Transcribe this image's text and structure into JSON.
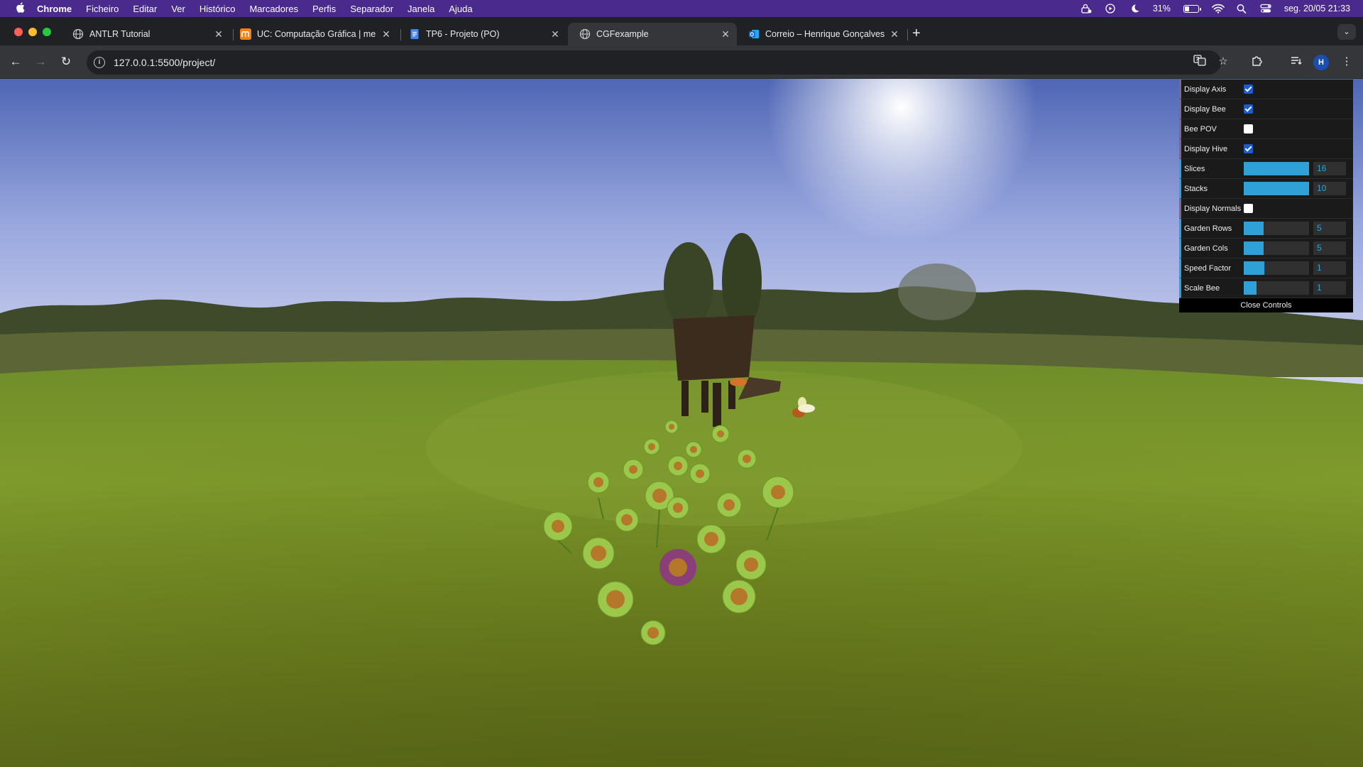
{
  "menubar": {
    "apple": "",
    "items": [
      "Chrome",
      "Ficheiro",
      "Editar",
      "Ver",
      "Histórico",
      "Marcadores",
      "Perfis",
      "Separador",
      "Janela",
      "Ajuda"
    ],
    "battery": "31%",
    "datetime": "seg. 20/05  21:33"
  },
  "tabs": [
    {
      "title": "ANTLR Tutorial",
      "favicon": "globe-icon"
    },
    {
      "title": "UC: Computação Gráfica | me",
      "favicon": "moodle-icon"
    },
    {
      "title": "TP6 - Projeto (PO)",
      "favicon": "docs-icon"
    },
    {
      "title": "CGFexample",
      "favicon": "globe-icon",
      "active": true
    },
    {
      "title": "Correio – Henrique Gonçalves",
      "favicon": "outlook-icon"
    }
  ],
  "toolbar": {
    "url": "127.0.0.1:5500/project/",
    "avatar": "H"
  },
  "gui": {
    "controls": [
      {
        "label": "Display Axis",
        "type": "bool",
        "checked": true
      },
      {
        "label": "Display Bee",
        "type": "bool",
        "checked": true
      },
      {
        "label": "Bee POV",
        "type": "bool",
        "checked": false
      },
      {
        "label": "Display Hive",
        "type": "bool",
        "checked": true
      },
      {
        "label": "Slices",
        "type": "number",
        "value": "16",
        "fill": 1.0
      },
      {
        "label": "Stacks",
        "type": "number",
        "value": "10",
        "fill": 1.0
      },
      {
        "label": "Display Normals",
        "type": "bool",
        "checked": false
      },
      {
        "label": "Garden Rows",
        "type": "number",
        "value": "5",
        "fill": 0.3
      },
      {
        "label": "Garden Cols",
        "type": "number",
        "value": "5",
        "fill": 0.3
      },
      {
        "label": "Speed Factor",
        "type": "number",
        "value": "1",
        "fill": 0.32
      },
      {
        "label": "Scale Bee",
        "type": "number",
        "value": "1",
        "fill": 0.2
      }
    ],
    "close_label": "Close Controls"
  },
  "colors": {
    "menubar": "#4a2a8c",
    "gui_number_accent": "#2fa1d6",
    "gui_bool_accent": "#806787"
  }
}
